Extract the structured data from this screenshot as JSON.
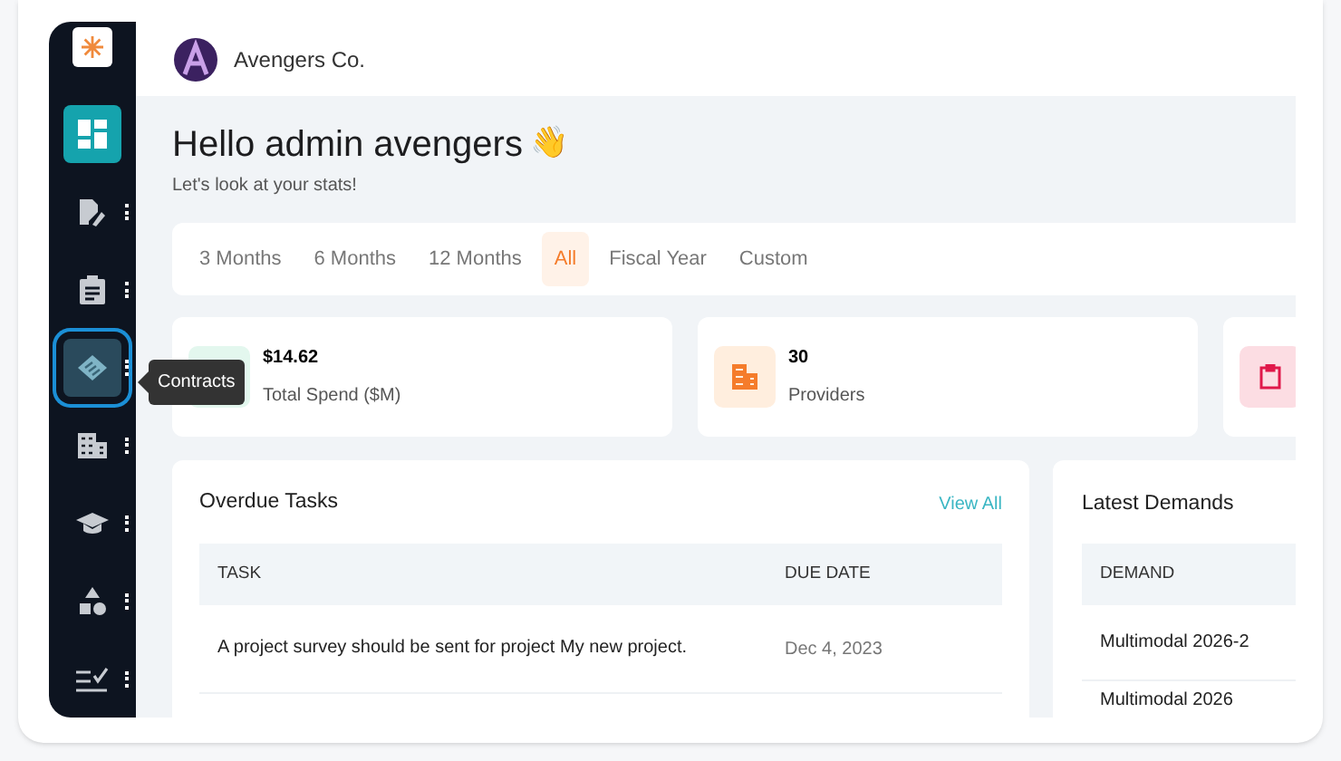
{
  "sidebar": {
    "items": [
      {
        "kind": "logo"
      },
      {
        "kind": "dashboard",
        "selected": true,
        "menu": false
      },
      {
        "kind": "document-edit",
        "selected": false,
        "menu": true
      },
      {
        "kind": "clipboard",
        "selected": false,
        "menu": true
      },
      {
        "kind": "handshake",
        "selected": false,
        "menu": true,
        "hovered": true,
        "tooltip": "Contracts"
      },
      {
        "kind": "building",
        "selected": false,
        "menu": true
      },
      {
        "kind": "graduation",
        "selected": false,
        "menu": true
      },
      {
        "kind": "shapes",
        "selected": false,
        "menu": true
      },
      {
        "kind": "checklist",
        "selected": false,
        "menu": true
      }
    ]
  },
  "header": {
    "company": "Avengers Co."
  },
  "greeting": {
    "title": "Hello admin avengers",
    "emoji": "👋",
    "subtitle": "Let's look at your stats!"
  },
  "period_tabs": [
    {
      "label": "3 Months",
      "selected": false
    },
    {
      "label": "6 Months",
      "selected": false
    },
    {
      "label": "12 Months",
      "selected": false
    },
    {
      "label": "All",
      "selected": true
    },
    {
      "label": "Fiscal Year",
      "selected": false
    },
    {
      "label": "Custom",
      "selected": false
    }
  ],
  "stats": [
    {
      "kind": "spend",
      "value": "$14.62",
      "label": "Total Spend ($M)"
    },
    {
      "kind": "providers",
      "value": "30",
      "label": "Providers"
    },
    {
      "kind": "clipboard"
    }
  ],
  "overdue_tasks": {
    "title": "Overdue Tasks",
    "link": "View All",
    "columns": [
      "TASK",
      "DUE DATE"
    ],
    "rows": [
      [
        "A project survey should be sent for project My new project.",
        "Dec 4, 2023"
      ]
    ]
  },
  "latest_demands": {
    "title": "Latest Demands",
    "columns": [
      "DEMAND"
    ],
    "rows": [
      [
        "Multimodal 2026-2"
      ],
      [
        "Multimodal 2026"
      ]
    ]
  }
}
